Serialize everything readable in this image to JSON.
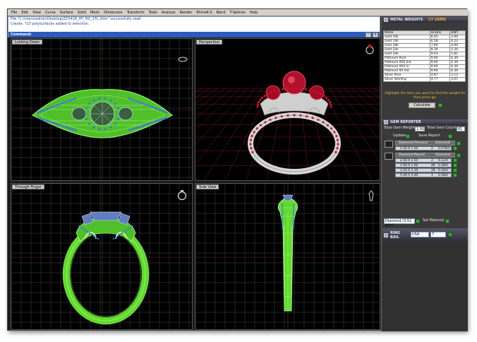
{
  "menu": [
    "File",
    "Edit",
    "View",
    "Curve",
    "Surface",
    "Solid",
    "Mesh",
    "Dimension",
    "Transform",
    "Tools",
    "Analyze",
    "Render",
    "Rhino4.0",
    "Bend",
    "T-Splines",
    "Help"
  ],
  "command": {
    "line1": "File \"C:\\Users\\admin\\Desktop\\ZZ3428_HT_RD_1TL.3dm\" successfully read",
    "line2": "Create: *23 polysurfaces added to selection.",
    "prompt": "Command:"
  },
  "viewports": {
    "top_left": "Looking Down",
    "top_right": "Perspective",
    "bottom_left": "Through Finger",
    "bottom_right": "Side View"
  },
  "metal_weights": {
    "title": "METAL WEIGHTS",
    "subtitle": "CT GEMS",
    "headers": [
      "Metal",
      "Grams",
      "DWT"
    ],
    "rows": [
      [
        "Gold 10k",
        "6.05",
        "3.94"
      ],
      [
        "Gold 14k",
        "6.58",
        "4.23"
      ],
      [
        "Gold 18k",
        "7.69",
        "4.94"
      ],
      [
        "Gold 22k",
        "8.30",
        "5.34"
      ],
      [
        "Gold 24k",
        "9.03",
        "5.81"
      ],
      [
        "Platinum Pure",
        "9.94",
        "6.39"
      ],
      [
        "Platinum 950 Ind",
        "9.94",
        "6.39"
      ],
      [
        "Platinum 950 Iri",
        "9.94",
        "6.39"
      ],
      [
        "Platinum 95 Ind",
        "9.94",
        "6.39"
      ],
      [
        "Silver Pure",
        "4.87",
        "3.13"
      ],
      [
        "Silver Sterling",
        "4.77",
        "3.07"
      ]
    ],
    "note": "Highlight the item you want to find the weight for then press go.",
    "calculate": "Calculate"
  },
  "gem_reporter": {
    "title": "GEM REPORTER",
    "total_weight_label": "Total Gem Weight",
    "total_weight_value": "1.91",
    "total_count_label": "Total Gem Count",
    "total_count_value": "81",
    "update": "Update",
    "save_report": "Save Report",
    "gems": [
      {
        "name": "Diamond Princess",
        "material": "Diamond",
        "sub": [
          [
            "2.50 X 1.50",
            "2",
            "0.078ct"
          ]
        ]
      },
      {
        "name": "Diamond Round",
        "material": "Diamond",
        "sub": [
          [
            "2.50 X 2.50",
            "2",
            "0.12ct"
          ],
          [
            "1.00 X 1.00",
            "48",
            "0.28ct"
          ],
          [
            "3.10 X 1.10",
            "28",
            "0.24ct"
          ],
          [
            "5.40 X 5.40",
            "1",
            "0.58ct"
          ]
        ]
      }
    ],
    "material_select": "Diamond",
    "material_select_value": "(3.52 g/cc)",
    "set_material": "Set Material"
  },
  "ring_bail": {
    "title": "RING BAIL",
    "size_std": "USA",
    "size": "7"
  },
  "colors": {
    "wire_green": "#7cff3a",
    "gem_blue": "#3a6cff",
    "grid": "#5a5a5a",
    "ruby": "#c0102a",
    "metal": "#d8d8d8",
    "persp_grid": "#8a1a2a"
  }
}
